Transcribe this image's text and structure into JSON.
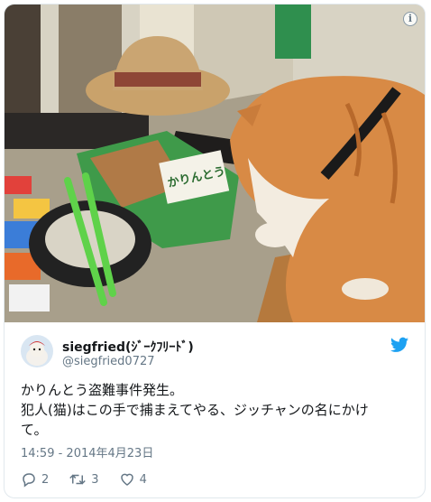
{
  "tweet": {
    "display_name": "siegfried(ｼﾞｰｸﾌﾘｰﾄﾞ)",
    "handle": "@siegfried0727",
    "text_lines": [
      "かりんとう盗難事件発生。",
      "犯人(猫)はこの手で捕まえてやる、ジッチャンの名にかけ",
      "て。"
    ],
    "timestamp": "14:59 - 2014年4月23日",
    "reply_count": "2",
    "retweet_count": "3",
    "like_count": "4"
  },
  "media": {
    "description_icon": "info-icon",
    "package_text": "かりんとう"
  },
  "colors": {
    "twitter_blue": "#1da1f2",
    "secondary_text": "#657786",
    "border": "#e1e8ed"
  },
  "icons": {
    "brand": "twitter-bird-icon",
    "reply": "reply-icon",
    "retweet": "retweet-icon",
    "like": "heart-icon"
  }
}
